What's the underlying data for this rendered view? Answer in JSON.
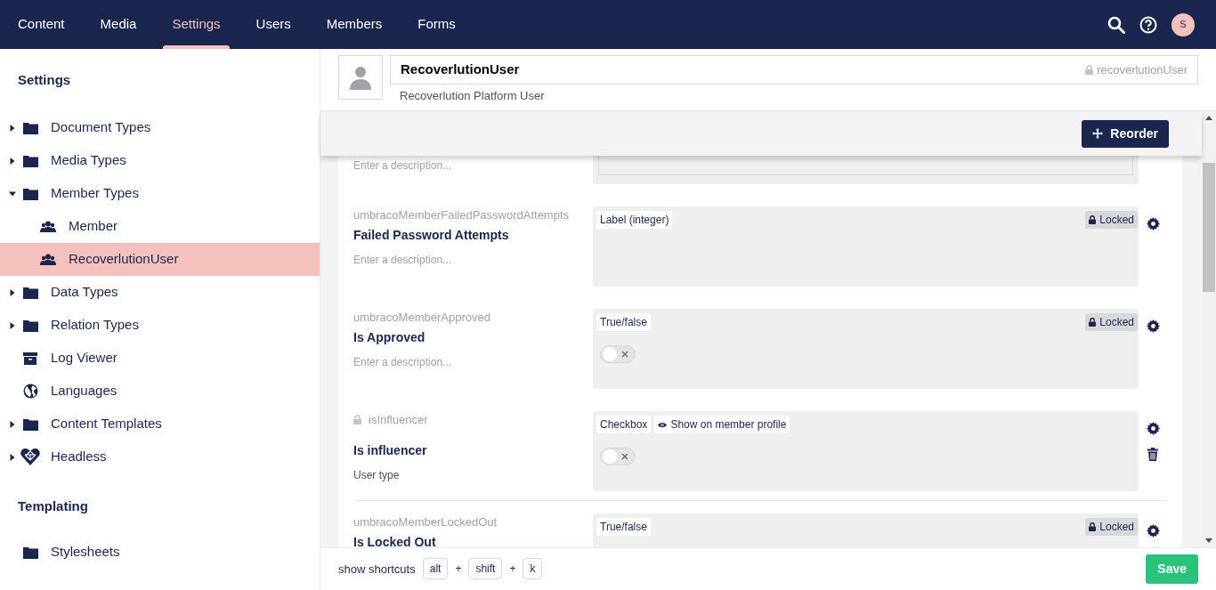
{
  "nav": {
    "tabs": [
      {
        "label": "Content",
        "selected": false
      },
      {
        "label": "Media",
        "selected": false
      },
      {
        "label": "Settings",
        "selected": true
      },
      {
        "label": "Users",
        "selected": false
      },
      {
        "label": "Members",
        "selected": false
      },
      {
        "label": "Forms",
        "selected": false
      }
    ],
    "avatar": "S"
  },
  "sidebar": {
    "sections": [
      {
        "title": "Settings",
        "items": [
          {
            "label": "Document Types",
            "kind": "folder",
            "expanded": false,
            "selected": false
          },
          {
            "label": "Media Types",
            "kind": "folder",
            "expanded": false,
            "selected": false
          },
          {
            "label": "Member Types",
            "kind": "folder",
            "expanded": true,
            "selected": false,
            "children": [
              {
                "label": "Member",
                "kind": "member",
                "selected": false
              },
              {
                "label": "RecoverlutionUser",
                "kind": "member",
                "selected": true
              }
            ]
          },
          {
            "label": "Data Types",
            "kind": "folder",
            "expanded": false,
            "selected": false
          },
          {
            "label": "Relation Types",
            "kind": "folder",
            "expanded": false,
            "selected": false
          },
          {
            "label": "Log Viewer",
            "kind": "archive",
            "selected": false
          },
          {
            "label": "Languages",
            "kind": "globe",
            "selected": false
          },
          {
            "label": "Content Templates",
            "kind": "folder",
            "expanded": false,
            "selected": false
          },
          {
            "label": "Headless",
            "kind": "heart",
            "expanded": false,
            "selected": false
          }
        ]
      },
      {
        "title": "Templating",
        "items": [
          {
            "label": "Stylesheets",
            "kind": "folder",
            "selected": false
          }
        ]
      }
    ]
  },
  "header": {
    "name": "RecoverlutionUser",
    "alias": "recoverlutionUser",
    "description": "Recoverlution Platform User"
  },
  "reorder_button": "Reorder",
  "properties": [
    {
      "description_field": {
        "placeholder": "Enter a description..."
      },
      "kind": "textarea"
    },
    {
      "alias": "umbracoMemberFailedPasswordAttempts",
      "alias_locked": false,
      "name": "Failed Password Attempts",
      "description_field": {
        "placeholder": "Enter a description..."
      },
      "tags": [
        "Label (integer)"
      ],
      "locked": true,
      "locked_label": "Locked",
      "kind": "label",
      "deletable": false
    },
    {
      "alias": "umbracoMemberApproved",
      "alias_locked": false,
      "name": "Is Approved",
      "description_field": {
        "placeholder": "Enter a description..."
      },
      "tags": [
        "True/false"
      ],
      "locked": true,
      "locked_label": "Locked",
      "kind": "toggle",
      "checked": false,
      "deletable": false
    },
    {
      "alias": "isInfluencer",
      "alias_locked": true,
      "name": "Is influencer",
      "description_field": {
        "value": "User type"
      },
      "tags": [
        "Checkbox"
      ],
      "visibility_tag": "Show on member profile",
      "locked": false,
      "kind": "toggle",
      "checked": false,
      "deletable": true
    },
    {
      "alias": "umbracoMemberLockedOut",
      "alias_locked": false,
      "name": "Is Locked Out",
      "tags": [
        "True/false"
      ],
      "locked": true,
      "locked_label": "Locked",
      "kind": "toggle",
      "deletable": false
    }
  ],
  "footer": {
    "shortcuts_label": "show shortcuts",
    "shortcut": [
      {
        "kind": "key",
        "text": "alt"
      },
      {
        "kind": "plus",
        "text": "+"
      },
      {
        "kind": "key",
        "text": "shift"
      },
      {
        "kind": "plus",
        "text": "+"
      },
      {
        "kind": "key",
        "text": "k"
      }
    ],
    "save_button": "Save"
  }
}
